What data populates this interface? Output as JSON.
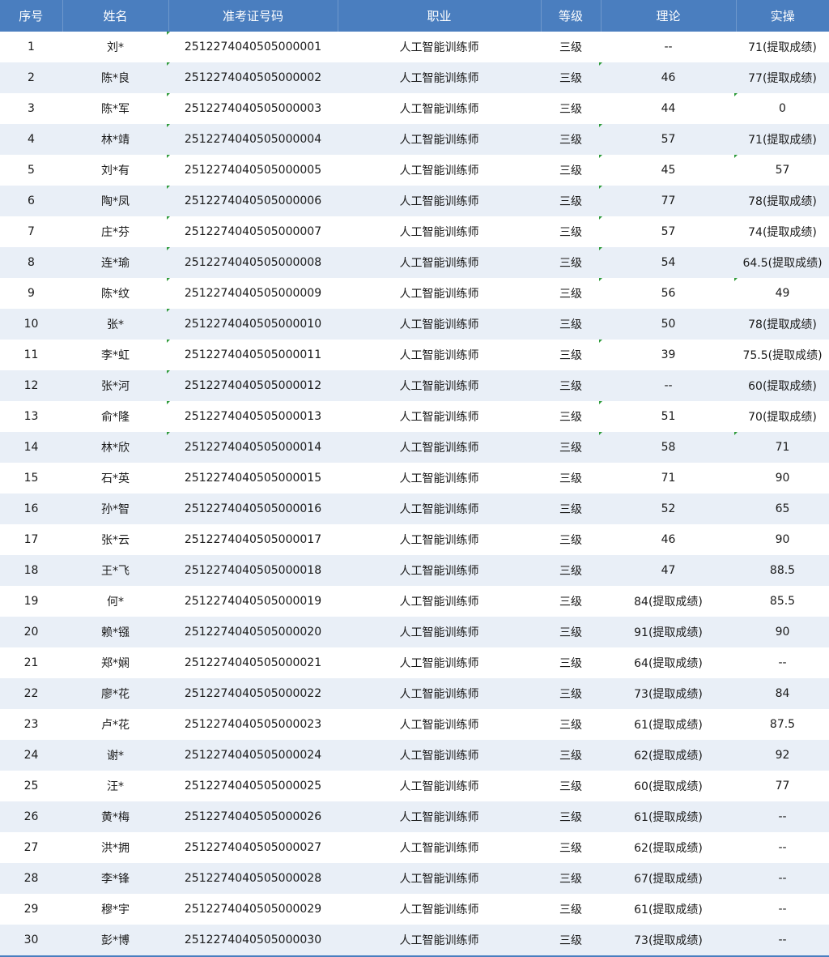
{
  "headers": [
    "序号",
    "姓名",
    "准考证号码",
    "职业",
    "等级",
    "理论",
    "实操"
  ],
  "rows": [
    [
      "1",
      "刘*",
      "2512274040505000001",
      "人工智能训练师",
      "三级",
      "--",
      "71(提取成绩)"
    ],
    [
      "2",
      "陈*良",
      "2512274040505000002",
      "人工智能训练师",
      "三级",
      "46",
      "77(提取成绩)"
    ],
    [
      "3",
      "陈*军",
      "2512274040505000003",
      "人工智能训练师",
      "三级",
      "44",
      "0"
    ],
    [
      "4",
      "林*靖",
      "2512274040505000004",
      "人工智能训练师",
      "三级",
      "57",
      "71(提取成绩)"
    ],
    [
      "5",
      "刘*有",
      "2512274040505000005",
      "人工智能训练师",
      "三级",
      "45",
      "57"
    ],
    [
      "6",
      "陶*凤",
      "2512274040505000006",
      "人工智能训练师",
      "三级",
      "77",
      "78(提取成绩)"
    ],
    [
      "7",
      "庄*芬",
      "2512274040505000007",
      "人工智能训练师",
      "三级",
      "57",
      "74(提取成绩)"
    ],
    [
      "8",
      "连*瑜",
      "2512274040505000008",
      "人工智能训练师",
      "三级",
      "54",
      "64.5(提取成绩)"
    ],
    [
      "9",
      "陈*纹",
      "2512274040505000009",
      "人工智能训练师",
      "三级",
      "56",
      "49"
    ],
    [
      "10",
      "张*",
      "2512274040505000010",
      "人工智能训练师",
      "三级",
      "50",
      "78(提取成绩)"
    ],
    [
      "11",
      "李*虹",
      "2512274040505000011",
      "人工智能训练师",
      "三级",
      "39",
      "75.5(提取成绩)"
    ],
    [
      "12",
      "张*河",
      "2512274040505000012",
      "人工智能训练师",
      "三级",
      "--",
      "60(提取成绩)"
    ],
    [
      "13",
      "俞*隆",
      "2512274040505000013",
      "人工智能训练师",
      "三级",
      "51",
      "70(提取成绩)"
    ],
    [
      "14",
      "林*欣",
      "2512274040505000014",
      "人工智能训练师",
      "三级",
      "58",
      "71"
    ],
    [
      "15",
      "石*英",
      "2512274040505000015",
      "人工智能训练师",
      "三级",
      "71",
      "90"
    ],
    [
      "16",
      "孙*智",
      "2512274040505000016",
      "人工智能训练师",
      "三级",
      "52",
      "65"
    ],
    [
      "17",
      "张*云",
      "2512274040505000017",
      "人工智能训练师",
      "三级",
      "46",
      "90"
    ],
    [
      "18",
      "王*飞",
      "2512274040505000018",
      "人工智能训练师",
      "三级",
      "47",
      "88.5"
    ],
    [
      "19",
      "何*",
      "2512274040505000019",
      "人工智能训练师",
      "三级",
      "84(提取成绩)",
      "85.5"
    ],
    [
      "20",
      "赖*镪",
      "2512274040505000020",
      "人工智能训练师",
      "三级",
      "91(提取成绩)",
      "90"
    ],
    [
      "21",
      "郑*娴",
      "2512274040505000021",
      "人工智能训练师",
      "三级",
      "64(提取成绩)",
      "--"
    ],
    [
      "22",
      "廖*花",
      "2512274040505000022",
      "人工智能训练师",
      "三级",
      "73(提取成绩)",
      "84"
    ],
    [
      "23",
      "卢*花",
      "2512274040505000023",
      "人工智能训练师",
      "三级",
      "61(提取成绩)",
      "87.5"
    ],
    [
      "24",
      "谢*",
      "2512274040505000024",
      "人工智能训练师",
      "三级",
      "62(提取成绩)",
      "92"
    ],
    [
      "25",
      "汪*",
      "2512274040505000025",
      "人工智能训练师",
      "三级",
      "60(提取成绩)",
      "77"
    ],
    [
      "26",
      "黄*梅",
      "2512274040505000026",
      "人工智能训练师",
      "三级",
      "61(提取成绩)",
      "--"
    ],
    [
      "27",
      "洪*拥",
      "2512274040505000027",
      "人工智能训练师",
      "三级",
      "62(提取成绩)",
      "--"
    ],
    [
      "28",
      "李*锋",
      "2512274040505000028",
      "人工智能训练师",
      "三级",
      "67(提取成绩)",
      "--"
    ],
    [
      "29",
      "穆*宇",
      "2512274040505000029",
      "人工智能训练师",
      "三级",
      "61(提取成绩)",
      "--"
    ],
    [
      "30",
      "彭*博",
      "2512274040505000030",
      "人工智能训练师",
      "三级",
      "73(提取成绩)",
      "--"
    ]
  ],
  "colors": {
    "header_bg": "#4a7ebf",
    "header_text": "#ffffff",
    "band_row_bg": "#e9eff7",
    "cell_marker": "#2e9b3a"
  }
}
